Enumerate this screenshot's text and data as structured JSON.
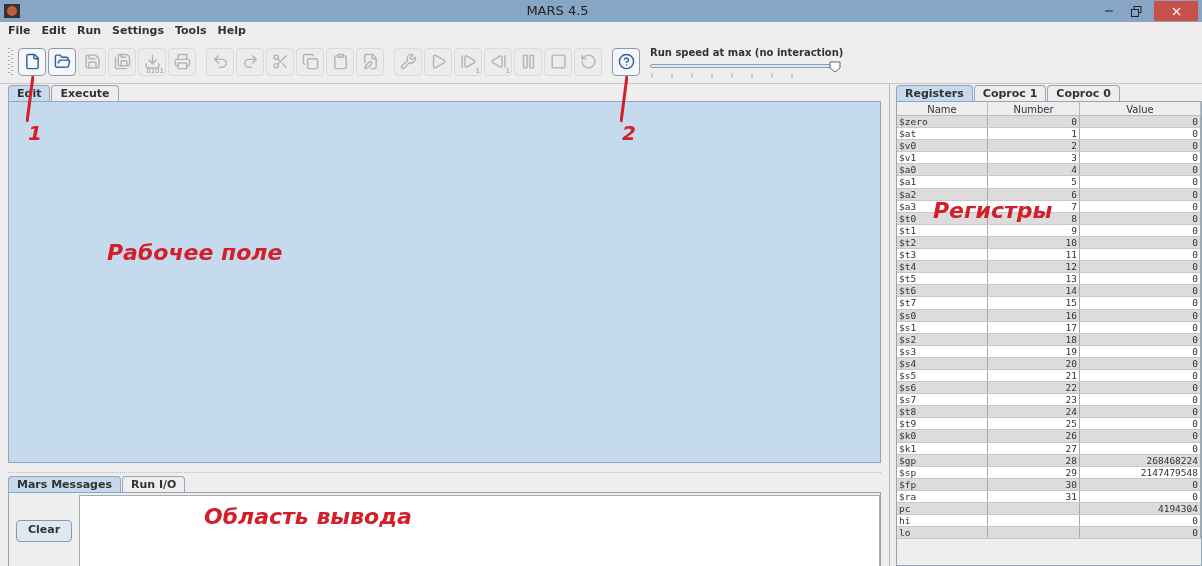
{
  "window": {
    "title": "MARS 4.5"
  },
  "menu": [
    "File",
    "Edit",
    "Run",
    "Settings",
    "Tools",
    "Help"
  ],
  "toolbar": [
    {
      "kind": "new",
      "enabled": true,
      "callout": "1"
    },
    {
      "kind": "open",
      "enabled": true
    },
    {
      "kind": "save",
      "enabled": false
    },
    {
      "kind": "save-as",
      "enabled": false
    },
    {
      "kind": "dump",
      "enabled": false,
      "label": "0101"
    },
    {
      "kind": "print",
      "enabled": false
    },
    {
      "kind": "undo",
      "enabled": false
    },
    {
      "kind": "redo",
      "enabled": false
    },
    {
      "kind": "cut",
      "enabled": false
    },
    {
      "kind": "copy",
      "enabled": false
    },
    {
      "kind": "paste",
      "enabled": false
    },
    {
      "kind": "find",
      "enabled": false
    },
    {
      "kind": "assemble",
      "enabled": false
    },
    {
      "kind": "go",
      "enabled": false
    },
    {
      "kind": "step",
      "enabled": false,
      "label": "1"
    },
    {
      "kind": "backstep",
      "enabled": false,
      "label": "1"
    },
    {
      "kind": "pause",
      "enabled": false
    },
    {
      "kind": "stop",
      "enabled": false
    },
    {
      "kind": "reset",
      "enabled": false
    },
    {
      "kind": "help",
      "enabled": true,
      "callout": "2"
    }
  ],
  "speed": {
    "label": "Run speed at max (no interaction)",
    "level": 0.95
  },
  "editor_tabs": [
    {
      "label": "Edit",
      "selected": true
    },
    {
      "label": "Execute",
      "selected": false
    }
  ],
  "editor": {
    "annotation": "Рабочее поле"
  },
  "message_tabs": [
    {
      "label": "Mars Messages",
      "selected": true
    },
    {
      "label": "Run I/O",
      "selected": false
    }
  ],
  "messages": {
    "button": "Clear",
    "annotation": "Область вывода"
  },
  "register_tabs": [
    {
      "label": "Registers",
      "selected": true
    },
    {
      "label": "Coproc 1",
      "selected": false
    },
    {
      "label": "Coproc 0",
      "selected": false
    }
  ],
  "registers": {
    "annotation": "Регистры",
    "columns": [
      "Name",
      "Number",
      "Value"
    ],
    "rows": [
      {
        "name": "$zero",
        "number": "0",
        "value": "0"
      },
      {
        "name": "$at",
        "number": "1",
        "value": "0"
      },
      {
        "name": "$v0",
        "number": "2",
        "value": "0"
      },
      {
        "name": "$v1",
        "number": "3",
        "value": "0"
      },
      {
        "name": "$a0",
        "number": "4",
        "value": "0"
      },
      {
        "name": "$a1",
        "number": "5",
        "value": "0"
      },
      {
        "name": "$a2",
        "number": "6",
        "value": "0"
      },
      {
        "name": "$a3",
        "number": "7",
        "value": "0"
      },
      {
        "name": "$t0",
        "number": "8",
        "value": "0"
      },
      {
        "name": "$t1",
        "number": "9",
        "value": "0"
      },
      {
        "name": "$t2",
        "number": "10",
        "value": "0"
      },
      {
        "name": "$t3",
        "number": "11",
        "value": "0"
      },
      {
        "name": "$t4",
        "number": "12",
        "value": "0"
      },
      {
        "name": "$t5",
        "number": "13",
        "value": "0"
      },
      {
        "name": "$t6",
        "number": "14",
        "value": "0"
      },
      {
        "name": "$t7",
        "number": "15",
        "value": "0"
      },
      {
        "name": "$s0",
        "number": "16",
        "value": "0"
      },
      {
        "name": "$s1",
        "number": "17",
        "value": "0"
      },
      {
        "name": "$s2",
        "number": "18",
        "value": "0"
      },
      {
        "name": "$s3",
        "number": "19",
        "value": "0"
      },
      {
        "name": "$s4",
        "number": "20",
        "value": "0"
      },
      {
        "name": "$s5",
        "number": "21",
        "value": "0"
      },
      {
        "name": "$s6",
        "number": "22",
        "value": "0"
      },
      {
        "name": "$s7",
        "number": "23",
        "value": "0"
      },
      {
        "name": "$t8",
        "number": "24",
        "value": "0"
      },
      {
        "name": "$t9",
        "number": "25",
        "value": "0"
      },
      {
        "name": "$k0",
        "number": "26",
        "value": "0"
      },
      {
        "name": "$k1",
        "number": "27",
        "value": "0"
      },
      {
        "name": "$gp",
        "number": "28",
        "value": "268468224"
      },
      {
        "name": "$sp",
        "number": "29",
        "value": "2147479548"
      },
      {
        "name": "$fp",
        "number": "30",
        "value": "0"
      },
      {
        "name": "$ra",
        "number": "31",
        "value": "0"
      },
      {
        "name": "pc",
        "value": "4194304"
      },
      {
        "name": "hi",
        "value": "0"
      },
      {
        "name": "lo",
        "value": "0"
      }
    ]
  }
}
